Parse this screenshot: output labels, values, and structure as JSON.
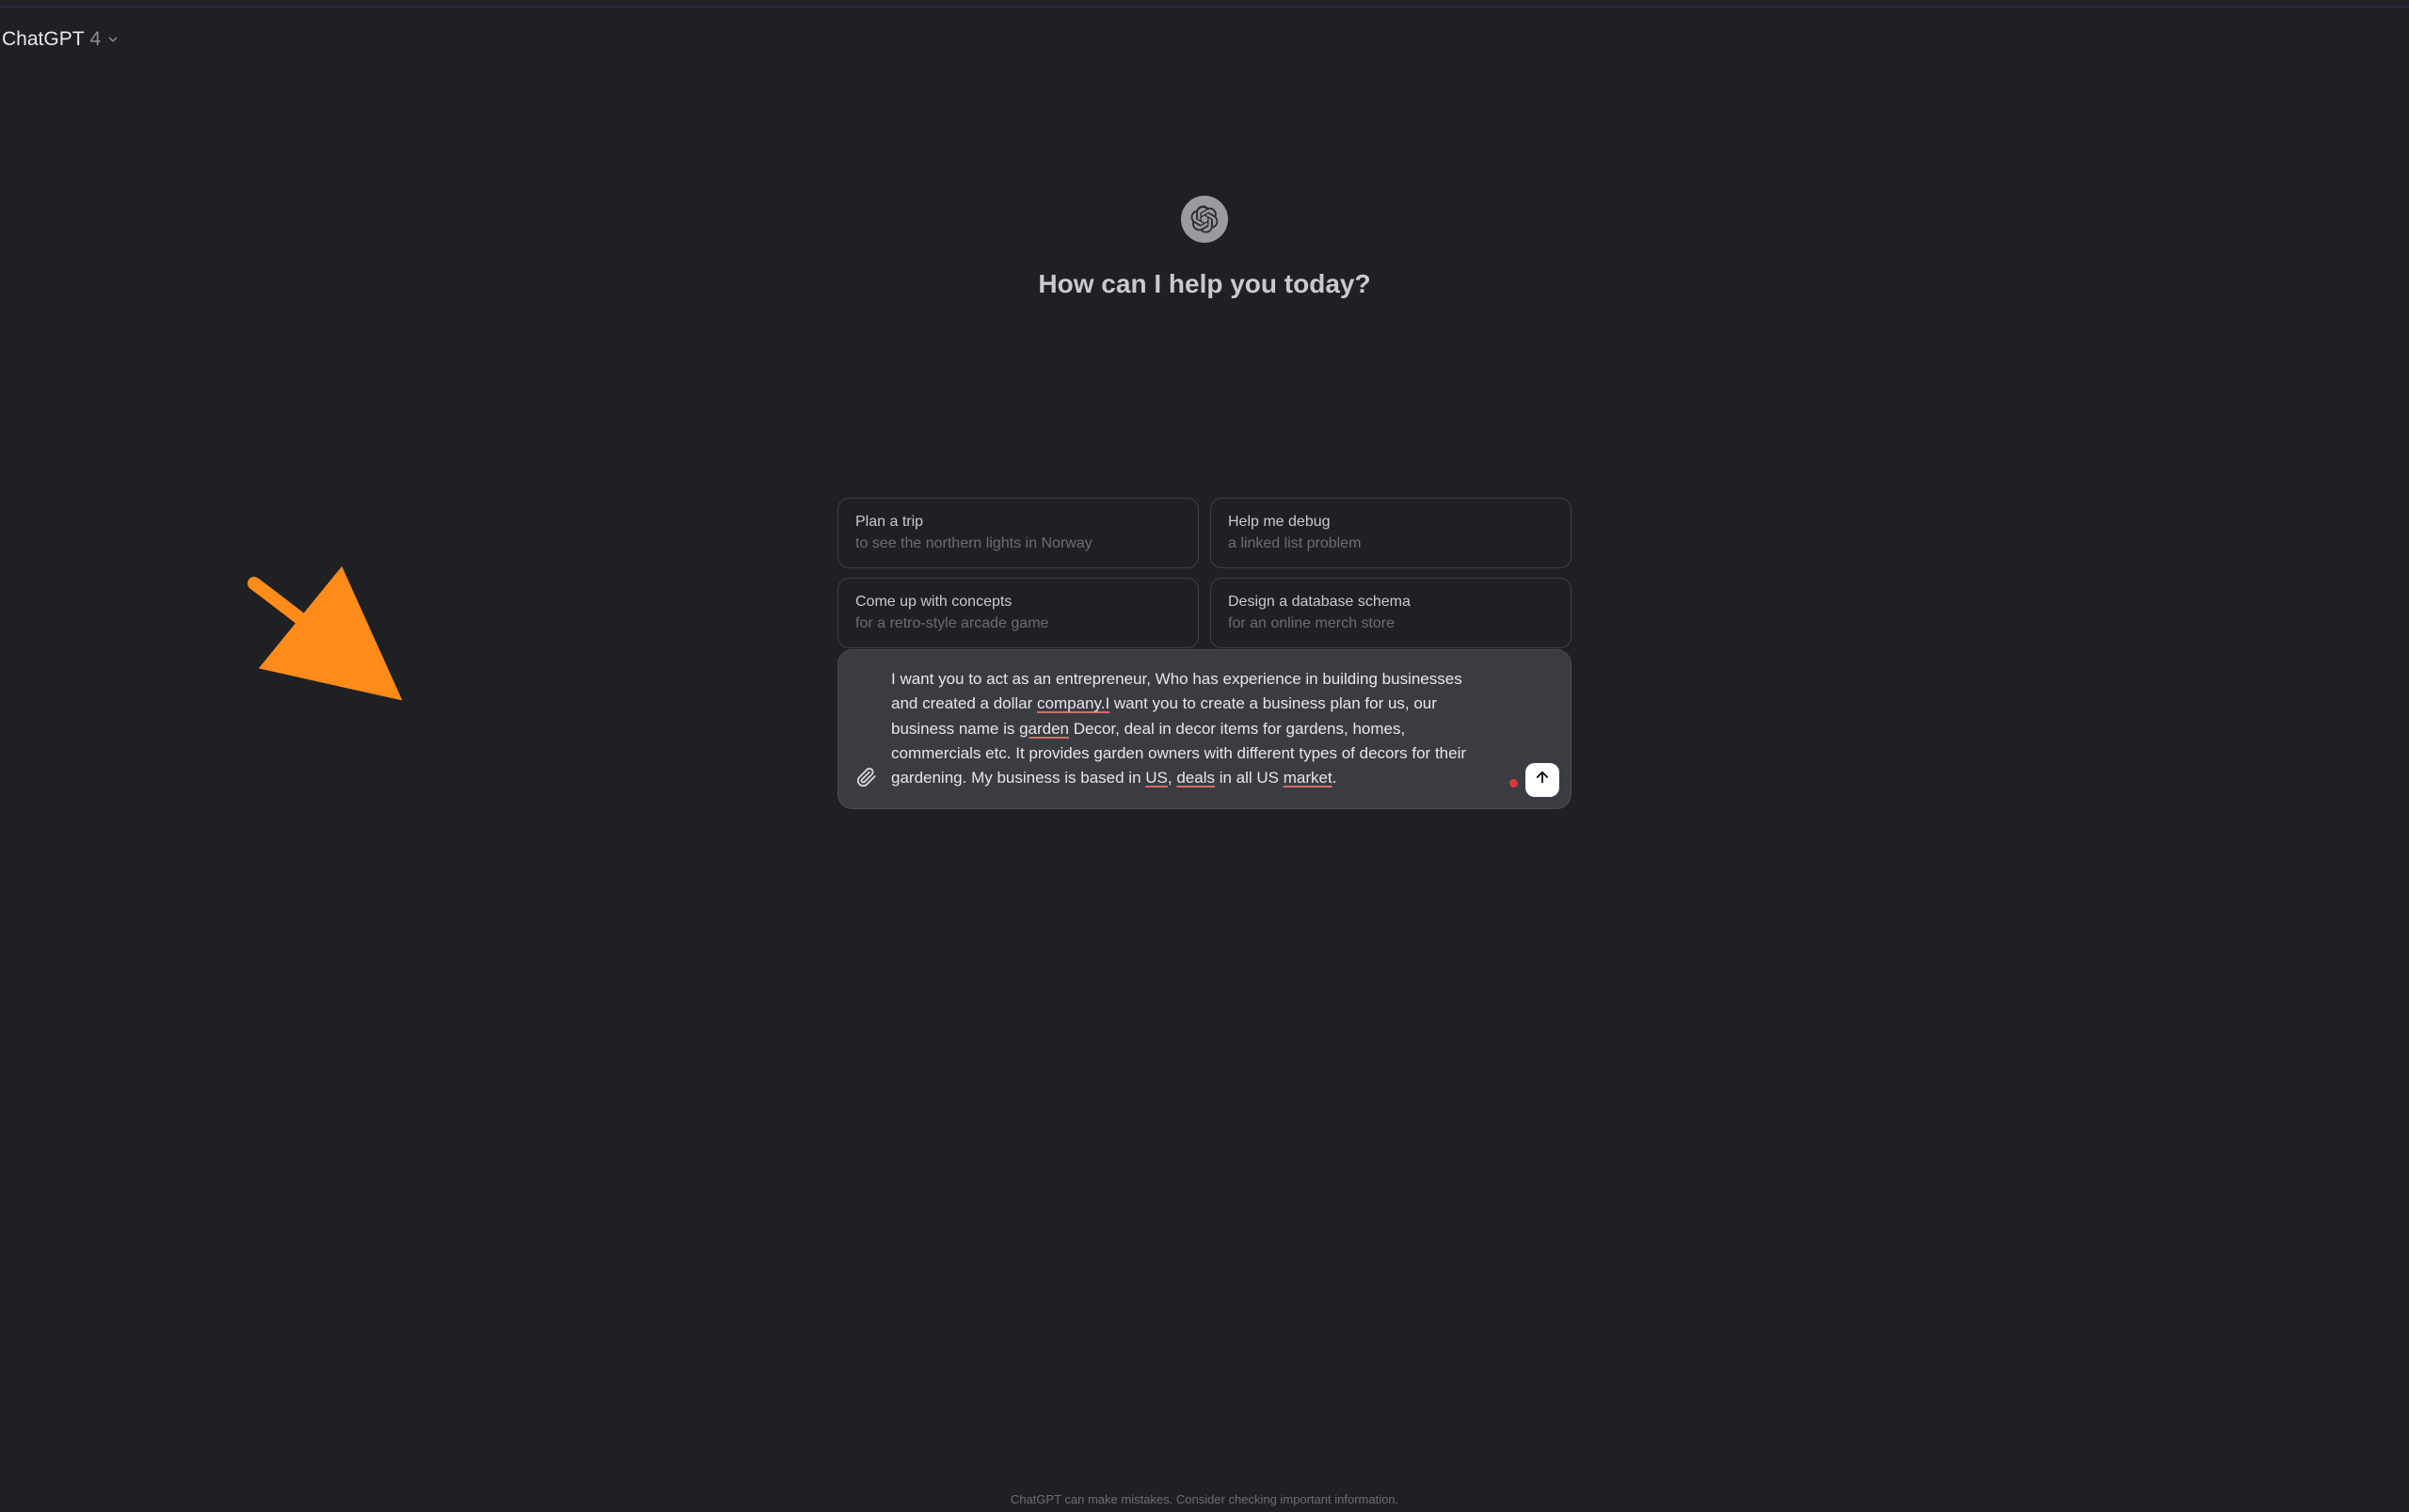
{
  "header": {
    "model_name": "ChatGPT",
    "model_version": "4"
  },
  "hero": {
    "title": "How can I help you today?"
  },
  "suggestions": [
    {
      "title": "Plan a trip",
      "sub": "to see the northern lights in Norway"
    },
    {
      "title": "Help me debug",
      "sub": "a linked list problem"
    },
    {
      "title": "Come up with concepts",
      "sub": "for a retro-style arcade game"
    },
    {
      "title": "Design a database schema",
      "sub": "for an online merch store"
    }
  ],
  "input": {
    "segments": [
      {
        "t": "I want you to act as an entrepreneur, Who has experience in building businesses and created a dollar "
      },
      {
        "t": "company.I",
        "u": true
      },
      {
        "t": " want you to create a business plan for us, our business name is "
      },
      {
        "t": "garden",
        "u": true
      },
      {
        "t": " Decor, deal in decor items for gardens, homes, commercials etc. It provides garden owners with different types of decors for their gardening. My business is based in "
      },
      {
        "t": "US",
        "u": true
      },
      {
        "t": ", "
      },
      {
        "t": "deals",
        "u": true
      },
      {
        "t": " in all US "
      },
      {
        "t": "market",
        "u": true
      },
      {
        "t": "."
      }
    ]
  },
  "icons": {
    "attach": "paperclip",
    "send": "arrow-up"
  },
  "footer": {
    "disclaimer": "ChatGPT can make mistakes. Consider checking important information."
  }
}
